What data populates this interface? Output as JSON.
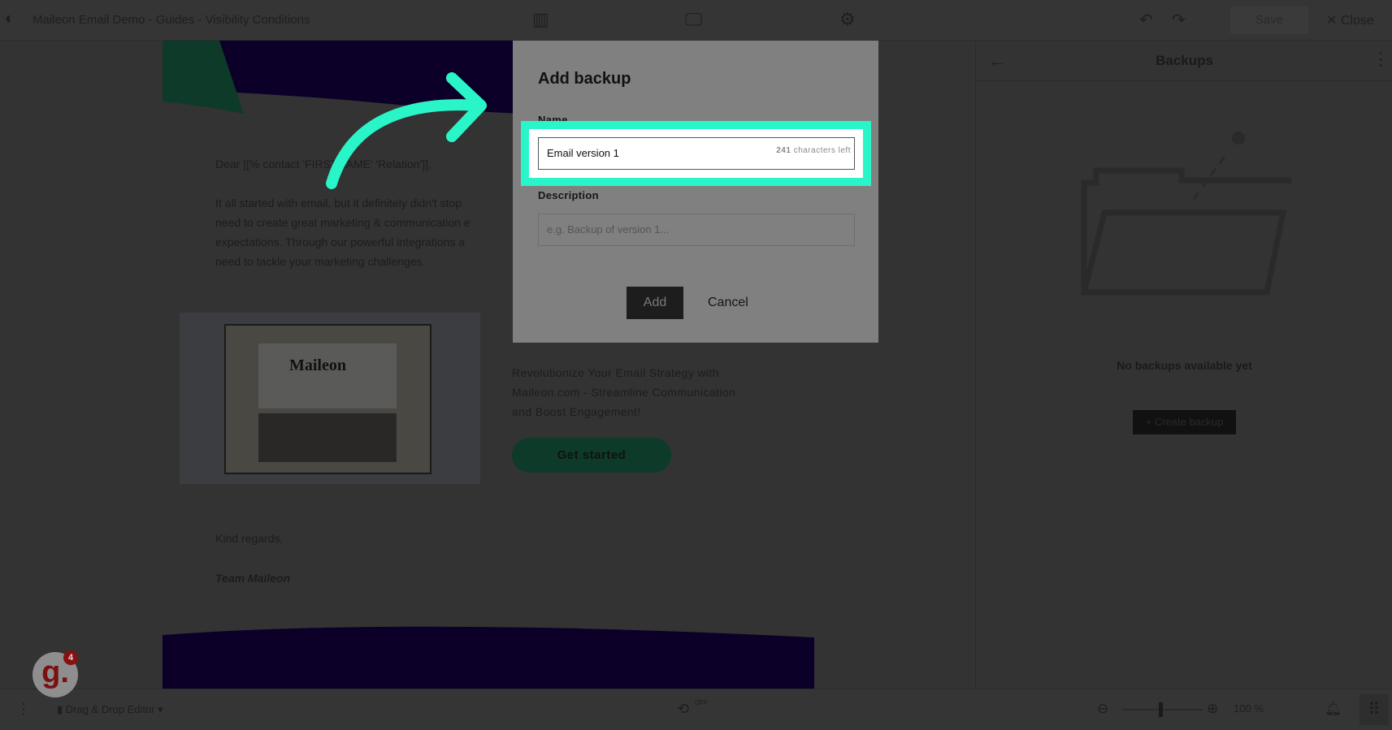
{
  "topbar": {
    "title": "Maileon Email Demo - Guides - Visibility Conditions",
    "save": "Save",
    "close": "Close",
    "icons": [
      "layout-icon",
      "desktop-preview-icon",
      "settings-gear-icon",
      "undo-icon",
      "redo-icon"
    ]
  },
  "email": {
    "greeting": "Dear [[% contact 'FIRSTNAME' 'Relation']],",
    "paragraph": [
      "It all started with email, but it definitely didn't stop",
      "need to create great marketing & communication e",
      "expectations. Through our powerful integrations a",
      "need to tackle your marketing challenges."
    ],
    "image_text": "Maileon",
    "promo": [
      "Revolutionize Your Email Strategy with",
      "Maileon.com - Streamline Communication",
      "and Boost Engagement!"
    ],
    "cta": "Get started",
    "closing": "Kind regards,",
    "signature": "Team Maileon",
    "colors": {
      "brand_purple": "#0d0028",
      "brand_green": "#0e3a2a"
    }
  },
  "panel": {
    "title": "Backups",
    "empty": "No backups available yet",
    "create": "Create backup"
  },
  "bottombar": {
    "editor": "Drag & Drop Editor",
    "toggle": "OFF",
    "zoom": "100 %",
    "badge_count": "4",
    "badge_letter": "g."
  },
  "modal": {
    "title": "Add backup",
    "name_label": "Name",
    "name_value": "Email version 1",
    "counter_num": "241",
    "counter_text": "characters left",
    "desc_label": "Description",
    "desc_placeholder": "e.g. Backup of version 1...",
    "add": "Add",
    "cancel": "Cancel"
  },
  "highlight_color": "#2af5c8"
}
